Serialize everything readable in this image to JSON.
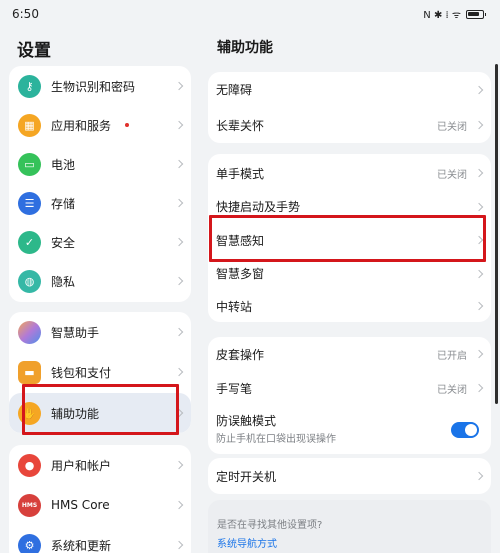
{
  "status_bar": {
    "time": "6:50",
    "icons_text": "N ✱ ⁞ ᯤ"
  },
  "left_panel": {
    "title": "设置",
    "groups": [
      [
        {
          "label": "生物识别和密码",
          "icon": "key-icon",
          "color": "#2bb39c"
        },
        {
          "label": "应用和服务",
          "icon": "apps-icon",
          "color": "#f5a623",
          "dot": true
        },
        {
          "label": "电池",
          "icon": "battery-icon",
          "color": "#35c25a"
        },
        {
          "label": "存储",
          "icon": "storage-icon",
          "color": "#2f6fe0"
        },
        {
          "label": "安全",
          "icon": "shield-icon",
          "color": "#2db88a"
        },
        {
          "label": "隐私",
          "icon": "privacy-icon",
          "color": "#35b8a6"
        }
      ],
      [
        {
          "label": "智慧助手",
          "icon": "assistant-icon",
          "color": "#b07ad8"
        },
        {
          "label": "钱包和支付",
          "icon": "wallet-icon",
          "color": "#f0a02c"
        },
        {
          "label": "辅助功能",
          "icon": "accessibility-icon",
          "color": "#f5a623",
          "selected": true
        }
      ],
      [
        {
          "label": "用户和帐户",
          "icon": "user-icon",
          "color": "#e8463b"
        },
        {
          "label": "HMS Core",
          "icon": "hms-icon",
          "color": "#d7403c",
          "glyph": "HMS"
        },
        {
          "label": "系统和更新",
          "icon": "system-icon",
          "color": "#2f6fe0"
        }
      ]
    ]
  },
  "right_panel": {
    "title": "辅助功能",
    "groups": [
      [
        {
          "label": "无障碍"
        },
        {
          "label": "长辈关怀",
          "value": "已关闭"
        }
      ],
      [
        {
          "label": "单手模式",
          "value": "已关闭"
        },
        {
          "label": "快捷启动及手势"
        },
        {
          "label": "智慧感知"
        },
        {
          "label": "智慧多窗"
        },
        {
          "label": "中转站"
        }
      ],
      [
        {
          "label": "皮套操作",
          "value": "已开启"
        },
        {
          "label": "手写笔",
          "value": "已关闭"
        },
        {
          "label": "防误触模式",
          "sub": "防止手机在口袋出现误操作",
          "toggle": true
        }
      ],
      [
        {
          "label": "定时开关机"
        }
      ]
    ],
    "suggestion": {
      "question": "是否在寻找其他设置项?",
      "link": "系统导航方式"
    }
  },
  "colors": {
    "accent": "#1a74e8",
    "highlight": "#d4161b"
  }
}
